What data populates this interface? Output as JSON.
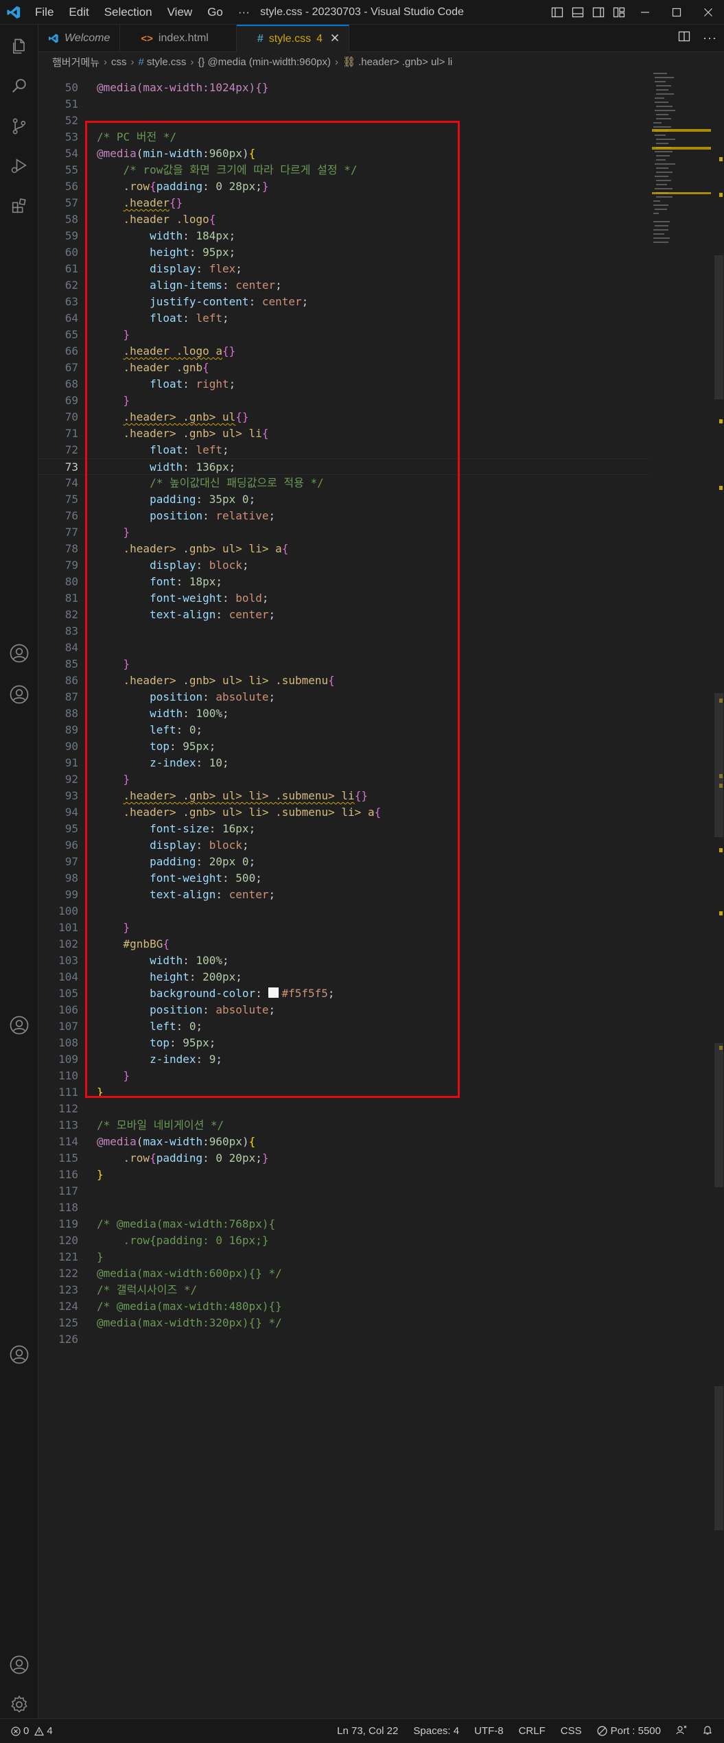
{
  "window": {
    "title": "style.css - 20230703 - Visual Studio Code"
  },
  "menu": [
    "File",
    "Edit",
    "Selection",
    "View",
    "Go",
    "···"
  ],
  "tabs": [
    {
      "label": "Welcome",
      "icon": "vscode-icon"
    },
    {
      "label": "index.html",
      "icon": "html-icon"
    },
    {
      "label": "style.css",
      "icon": "hash-icon",
      "problems": "4",
      "active": true
    }
  ],
  "breadcrumb": [
    "햄버거메뉴",
    "css",
    "style.css",
    "{} @media (min-width:960px)",
    ".header> .gnb> ul> li"
  ],
  "editor": {
    "first_line_partial": "@media(max-width:1024px){}",
    "lines": [
      "50",
      "51",
      "52",
      "53",
      "54",
      "55",
      "56",
      "57",
      "58",
      "59",
      "60",
      "61",
      "62",
      "63",
      "64",
      "65",
      "66",
      "67",
      "68",
      "69",
      "70",
      "71",
      "72",
      "73",
      "74",
      "75",
      "76",
      "77",
      "78",
      "79",
      "80",
      "81",
      "82",
      "83",
      "84",
      "85",
      "86",
      "87",
      "88",
      "89",
      "90",
      "91",
      "92",
      "93",
      "94",
      "95",
      "96",
      "97",
      "98",
      "99",
      "100",
      "101",
      "102",
      "103",
      "104",
      "105",
      "106",
      "107",
      "108",
      "109",
      "110",
      "111",
      "112",
      "113",
      "114",
      "115",
      "116",
      "117",
      "118",
      "119",
      "120",
      "121",
      "122",
      "123",
      "124",
      "125",
      "126"
    ],
    "current_line": "73"
  },
  "status": {
    "errors": "0",
    "warnings": "4",
    "position": "Ln 73, Col 22",
    "spaces": "Spaces: 4",
    "encoding": "UTF-8",
    "eol": "CRLF",
    "language": "CSS",
    "port": "Port : 5500"
  },
  "colors": {
    "accent": "#0078d4",
    "highlight_box": "#e50914",
    "comment": "#6a9955",
    "selector": "#d7ba7d",
    "property": "#9cdcfe",
    "value": "#ce9178",
    "number": "#b5cea8",
    "at_rule": "#c586c0"
  }
}
